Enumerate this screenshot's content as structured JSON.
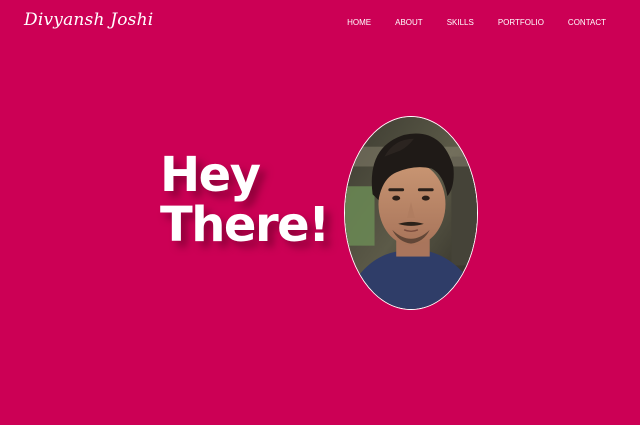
{
  "header": {
    "logo_text": "Divyansh Joshi",
    "nav": [
      {
        "label": "HOME"
      },
      {
        "label": "ABOUT"
      },
      {
        "label": "SKILLS"
      },
      {
        "label": "PORTFOLIO"
      },
      {
        "label": "CONTACT"
      }
    ]
  },
  "hero": {
    "title_line1": "Hey",
    "title_line2": "There!"
  },
  "colors": {
    "background": "#cc0055",
    "text": "#ffffff"
  }
}
